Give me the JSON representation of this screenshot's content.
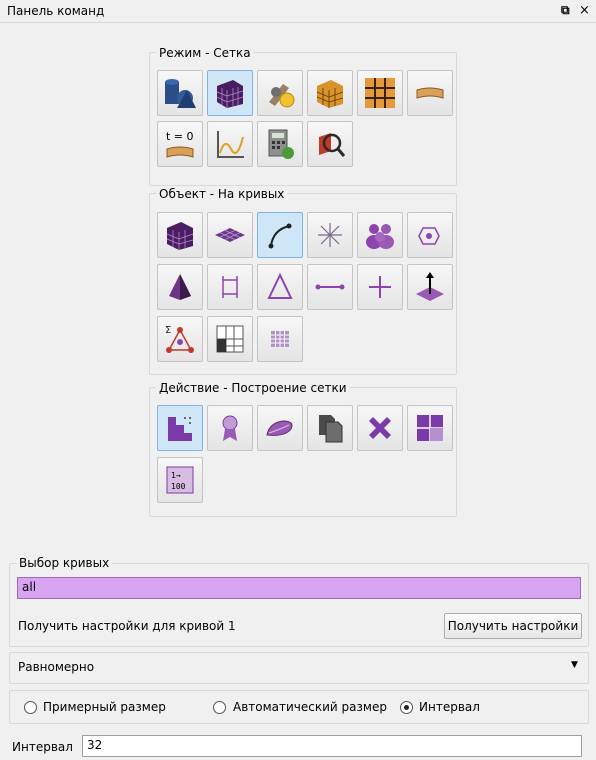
{
  "window": {
    "title": "Панель команд",
    "dock_icon": "dock-icon",
    "close_glyph": "×"
  },
  "groups": {
    "mode": {
      "title": "Режим - Сетка",
      "buttons": [
        "geometry-icon",
        "mesh-icon",
        "properties-icon",
        "volume-mesh-icon",
        "grid-icon",
        "sweep-icon",
        "time-zero-icon",
        "graph-icon",
        "calculator-icon",
        "inspect-icon"
      ],
      "time_label": "t = 0"
    },
    "object": {
      "title": "Объект - На кривых",
      "buttons": [
        "volume-icon",
        "surface-icon",
        "curve-icon",
        "vertex-icon",
        "group-icon",
        "node-icon",
        "tet-icon",
        "quad-icon",
        "tri-icon",
        "edge-icon",
        "point-icon",
        "normal-icon",
        "sum-icon",
        "grid-icon",
        "matrix-icon"
      ]
    },
    "action": {
      "title": "Действие - Построение сетки",
      "buttons": [
        "mesh-build-icon",
        "refine-icon",
        "smooth-icon",
        "copy-icon",
        "delete-icon",
        "split-icon",
        "renumber-icon"
      ],
      "renumber_label": "1→ 100"
    }
  },
  "curve_select": {
    "title": "Выбор кривых",
    "value": "all",
    "settings_label": "Получить настройки для кривой 1",
    "button": "Получить настройки"
  },
  "scheme": {
    "selected": "Равномерно",
    "arrow": "▼"
  },
  "size_mode": {
    "options": [
      "Примерный размер",
      "Автоматический размер",
      "Интервал"
    ],
    "selected_index": 2
  },
  "interval": {
    "label": "Интервал",
    "value": "32"
  },
  "colors": {
    "accent_input": "#d8a4f2",
    "active_button": "#cfe6f7",
    "icon_purple": "#7a3aa8"
  }
}
